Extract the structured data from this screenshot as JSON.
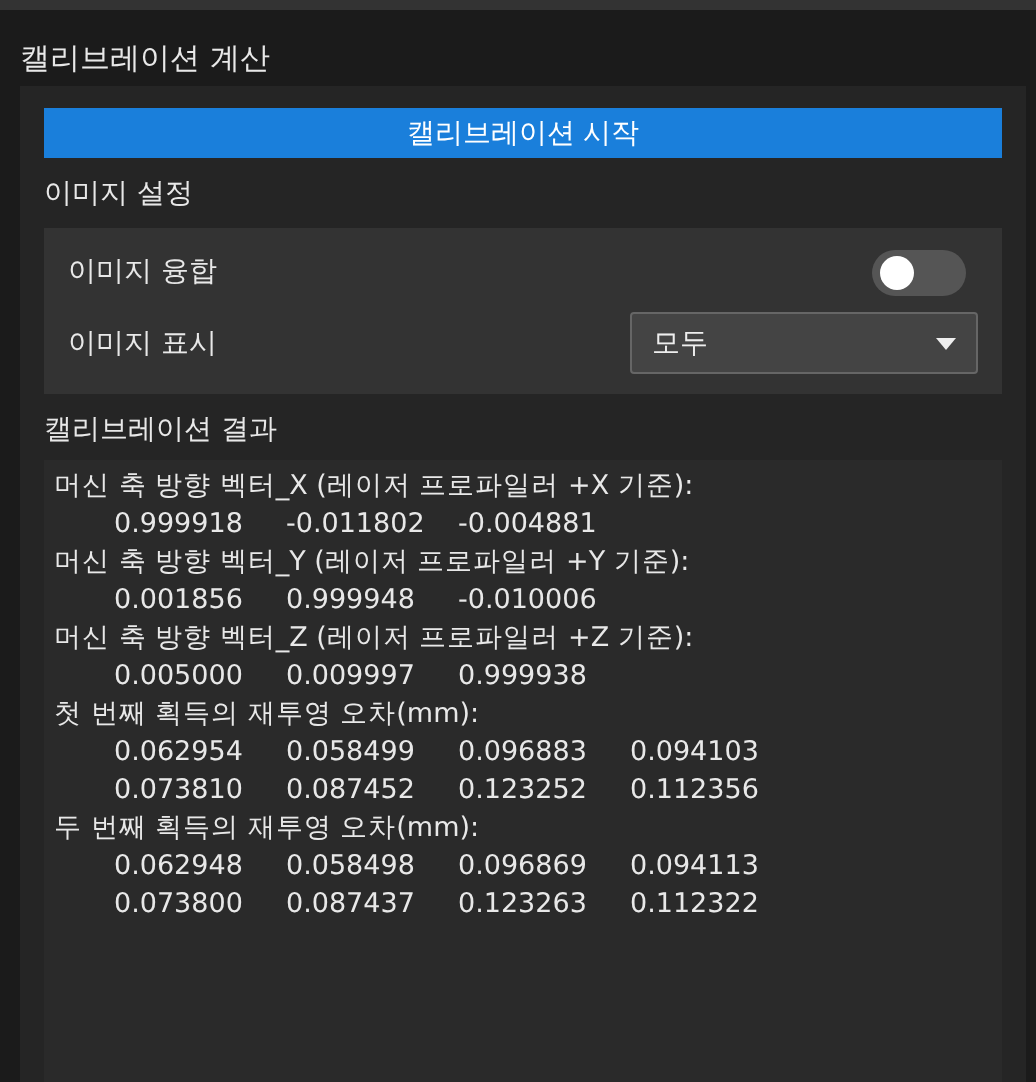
{
  "panel": {
    "title": "캘리브레이션 계산"
  },
  "start_button": {
    "label": "캘리브레이션 시작"
  },
  "image_settings": {
    "heading": "이미지 설정",
    "rows": [
      {
        "kind": "toggle",
        "label": "이미지 융합",
        "on": false
      },
      {
        "kind": "dropdown",
        "label": "이미지 표시",
        "value": "모두"
      }
    ]
  },
  "results": {
    "heading": "캘리브레이션 결과",
    "blocks": [
      {
        "heading": "머신 축 방향 벡터_X (레이저 프로파일러 +X 기준):",
        "rows": [
          [
            "0.999918",
            "-0.011802",
            "-0.004881"
          ]
        ]
      },
      {
        "heading": "머신 축 방향 벡터_Y (레이저 프로파일러 +Y 기준):",
        "rows": [
          [
            "0.001856",
            "0.999948",
            "-0.010006"
          ]
        ]
      },
      {
        "heading": "머신 축 방향 벡터_Z (레이저 프로파일러 +Z 기준):",
        "rows": [
          [
            "0.005000",
            "0.009997",
            "0.999938"
          ]
        ]
      },
      {
        "heading": "첫 번째 획득의 재투영 오차(mm):",
        "rows": [
          [
            "0.062954",
            "0.058499",
            "0.096883",
            "0.094103"
          ],
          [
            "0.073810",
            "0.087452",
            "0.123252",
            "0.112356"
          ]
        ]
      },
      {
        "heading": "두 번째 획득의 재투영 오차(mm):",
        "rows": [
          [
            "0.062948",
            "0.058498",
            "0.096869",
            "0.094113"
          ],
          [
            "0.073800",
            "0.087437",
            "0.123263",
            "0.112322"
          ]
        ]
      }
    ]
  }
}
